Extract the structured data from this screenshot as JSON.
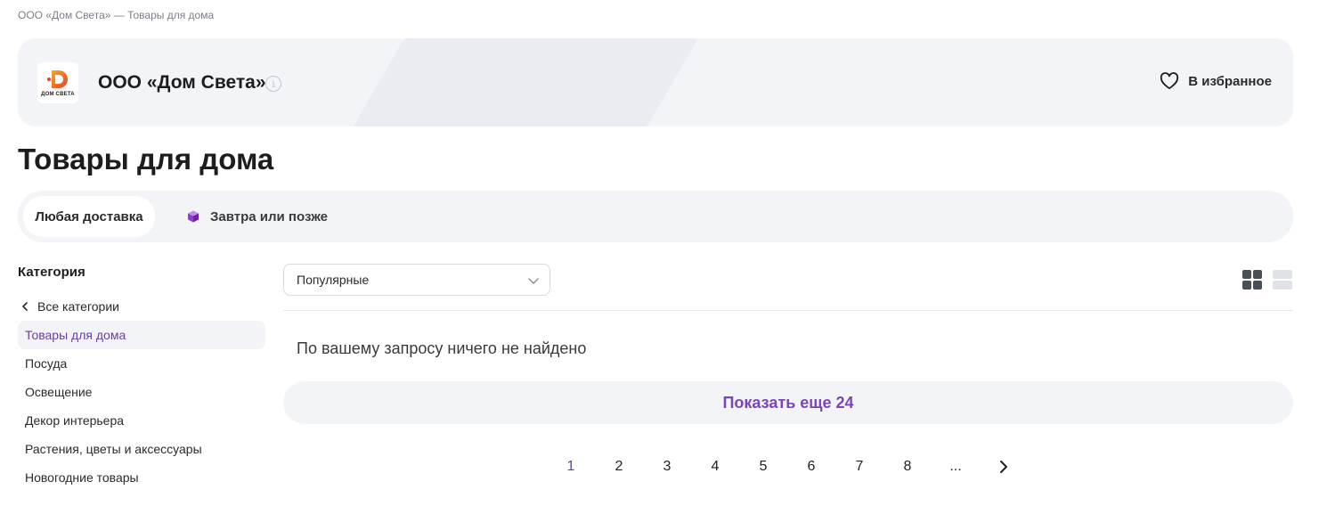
{
  "breadcrumb": "ООО «Дом Света» — Товары для дома",
  "seller": {
    "name": "ООО «Дом Света»",
    "logo_text": "ДОМ СВЕТА",
    "info_symbol": "i",
    "favorite_label": "В избранное"
  },
  "page_title": "Товары для дома",
  "delivery": {
    "tabs": [
      {
        "label": "Любая доставка"
      },
      {
        "label": "Завтра или позже"
      }
    ]
  },
  "sidebar": {
    "title": "Категория",
    "back_label": "Все категории",
    "items": [
      {
        "label": "Товары для дома"
      },
      {
        "label": "Посуда"
      },
      {
        "label": "Освещение"
      },
      {
        "label": "Декор интерьера"
      },
      {
        "label": "Растения, цветы и аксессуары"
      },
      {
        "label": "Новогодние товары"
      }
    ]
  },
  "sort": {
    "selected": "Популярные"
  },
  "results": {
    "empty_message": "По вашему запросу ничего не найдено"
  },
  "show_more_label": "Показать еще 24",
  "pagination": {
    "pages": [
      "1",
      "2",
      "3",
      "4",
      "5",
      "6",
      "7",
      "8",
      "..."
    ],
    "current": "1"
  },
  "colors": {
    "accent": "#7b45b8",
    "active_text": "#6b3fa0",
    "surface": "#f2f4f7",
    "logo_orange": "#f5a623",
    "logo_red": "#e8412c"
  },
  "icons": {
    "info": "info-icon",
    "favorite": "heart-icon",
    "delivery": "cube-icon",
    "back": "chevron-left-icon",
    "dropdown": "chevron-down-icon",
    "grid_view": "grid-view-icon",
    "list_view": "list-view-icon",
    "next": "chevron-right-icon"
  }
}
